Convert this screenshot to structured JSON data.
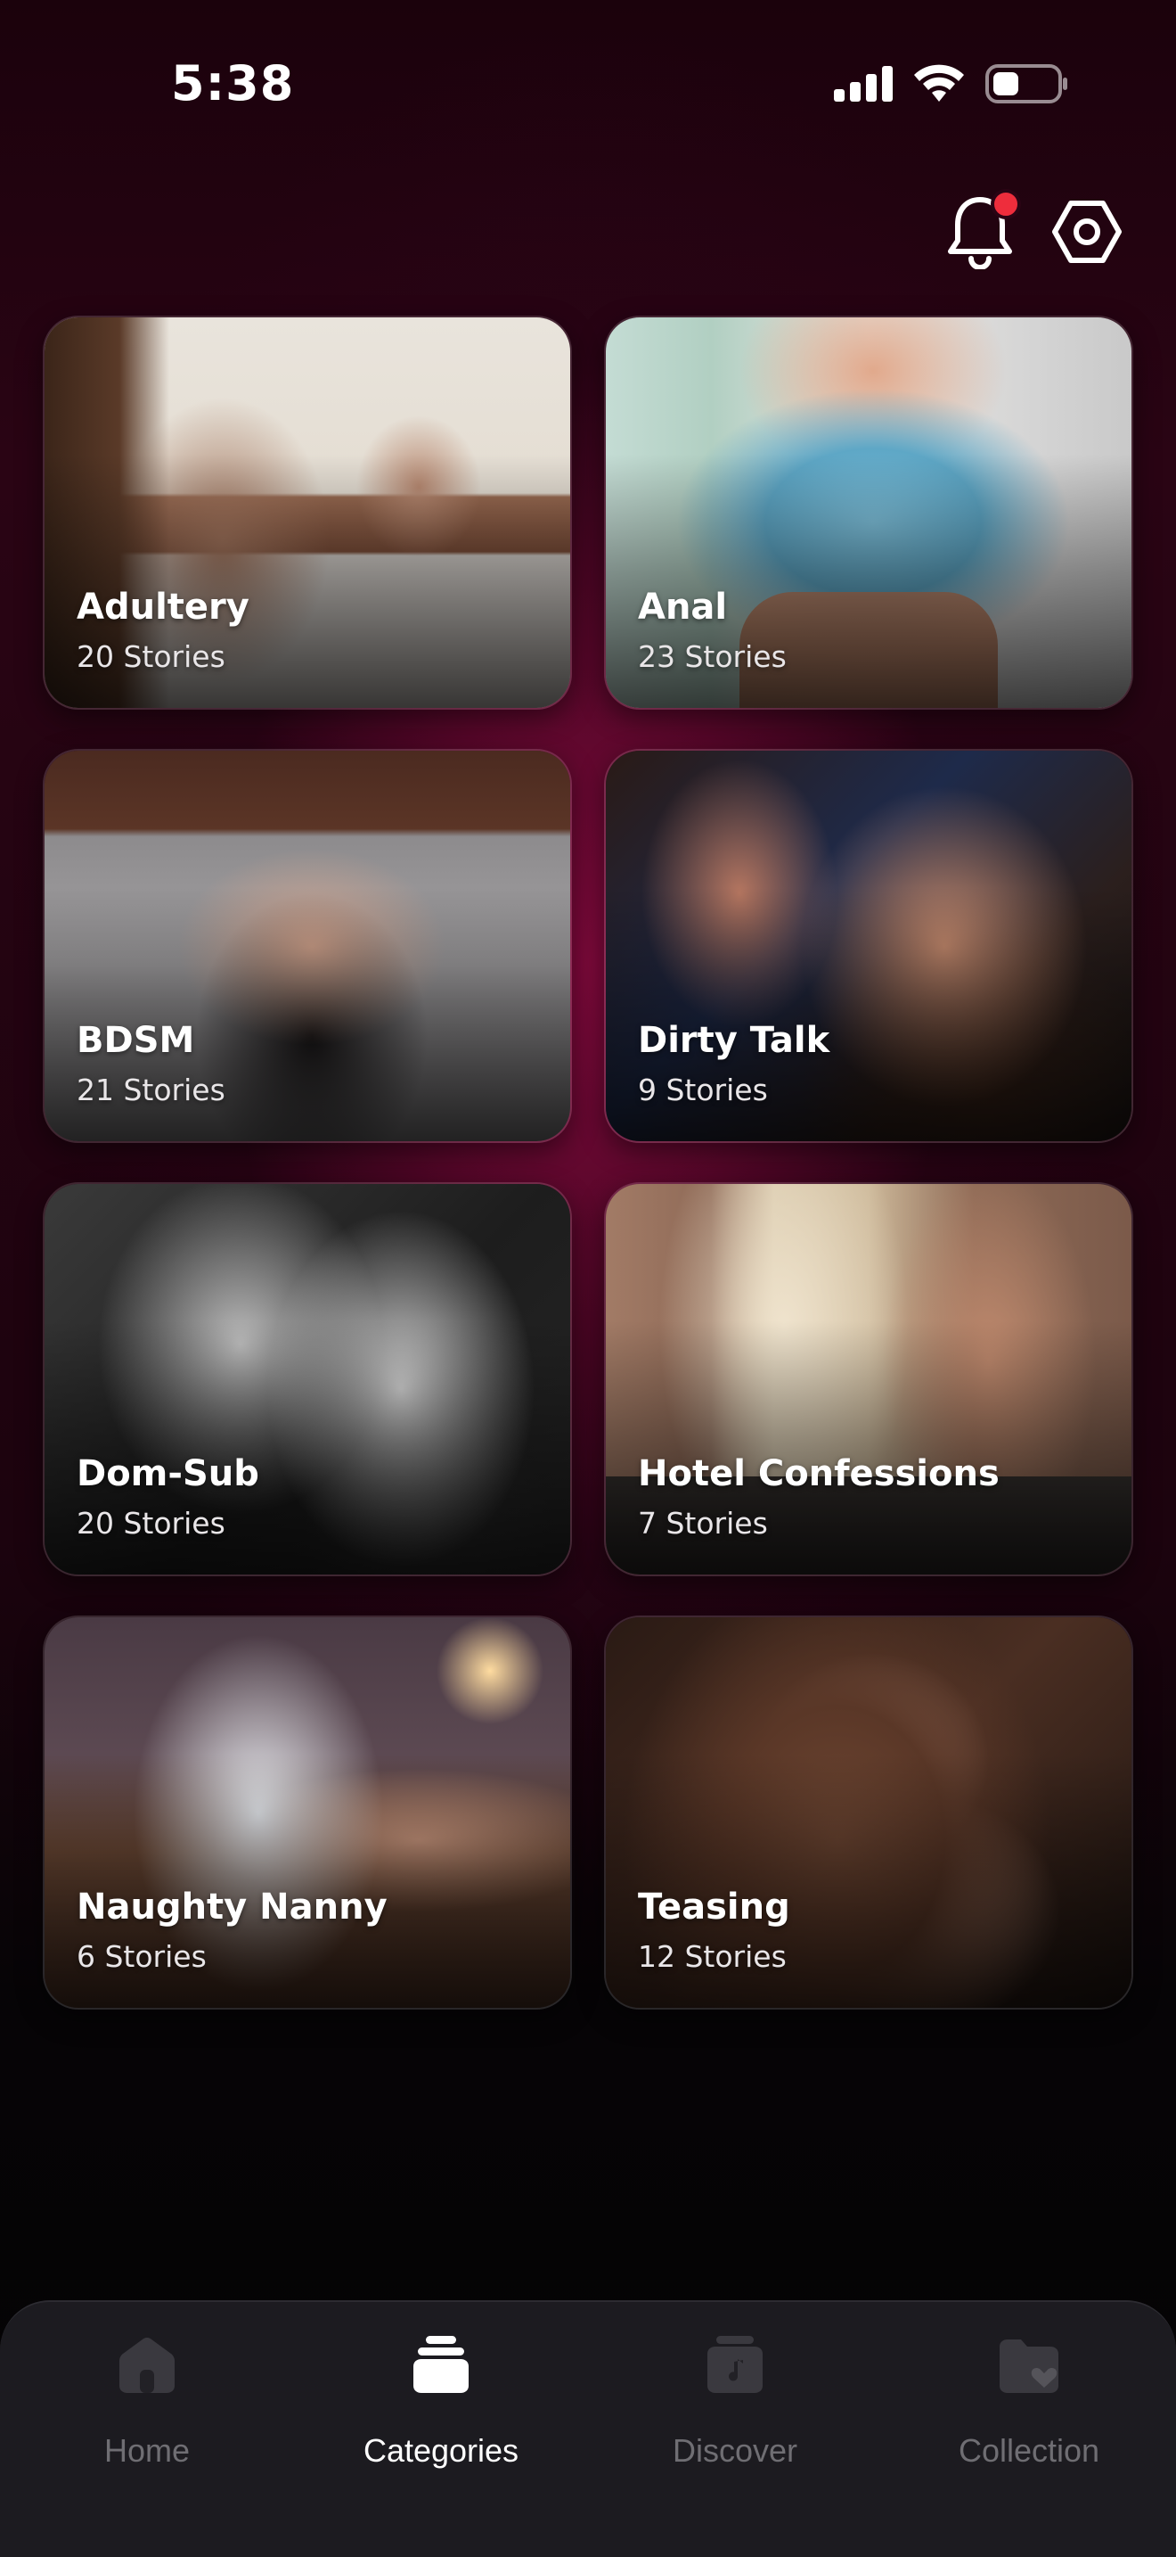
{
  "status_bar": {
    "time": "5:38"
  },
  "header": {
    "notification_badge": true
  },
  "categories": [
    {
      "title": "Adultery",
      "count": "20 Stories"
    },
    {
      "title": "Anal",
      "count": "23 Stories"
    },
    {
      "title": "BDSM",
      "count": "21 Stories"
    },
    {
      "title": "Dirty Talk",
      "count": "9 Stories"
    },
    {
      "title": "Dom-Sub",
      "count": "20 Stories"
    },
    {
      "title": "Hotel Confessions",
      "count": "7 Stories"
    },
    {
      "title": "Naughty Nanny",
      "count": "6 Stories"
    },
    {
      "title": "Teasing",
      "count": "12 Stories"
    }
  ],
  "tab_bar": {
    "items": [
      {
        "label": "Home",
        "icon": "home-icon",
        "active": false
      },
      {
        "label": "Categories",
        "icon": "categories-icon",
        "active": true
      },
      {
        "label": "Discover",
        "icon": "discover-icon",
        "active": false
      },
      {
        "label": "Collection",
        "icon": "collection-icon",
        "active": false
      }
    ]
  },
  "colors": {
    "accent_glow": "#840a3e",
    "notification_dot": "#ee2d3c",
    "tab_bar_bg": "#1c1b20",
    "tab_inactive": "#6f6e73",
    "tab_active": "#ffffff"
  }
}
